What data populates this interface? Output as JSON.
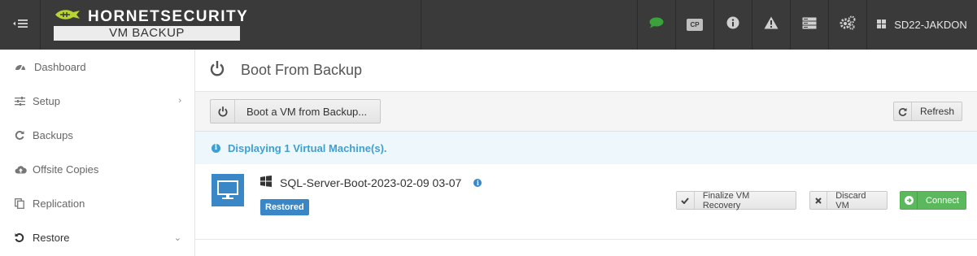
{
  "brand": {
    "name": "HORNETSECURITY",
    "product": "VM BACKUP"
  },
  "topnav": {
    "icons": [
      "chat-icon",
      "cp-icon",
      "info-icon",
      "warning-icon",
      "server-icon",
      "settings-icon"
    ],
    "cp_label": "CP",
    "user": "SD22-JAKDON"
  },
  "sidebar": {
    "items": [
      {
        "label": "Dashboard",
        "icon": "dashboard-icon"
      },
      {
        "label": "Setup",
        "icon": "sliders-icon",
        "chevron": "›"
      },
      {
        "label": "Backups",
        "icon": "refresh-icon"
      },
      {
        "label": "Offsite Copies",
        "icon": "cloud-upload-icon"
      },
      {
        "label": "Replication",
        "icon": "copy-icon"
      },
      {
        "label": "Restore",
        "icon": "undo-icon",
        "chevron": "⌄"
      }
    ]
  },
  "page": {
    "title": "Boot From Backup"
  },
  "toolbar": {
    "boot_label": "Boot a VM from Backup...",
    "refresh_label": "Refresh"
  },
  "info": {
    "message": "Displaying 1 Virtual Machine(s)."
  },
  "vm": {
    "name": "SQL-Server-Boot-2023-02-09 03-07",
    "status": "Restored",
    "actions": {
      "finalize": "Finalize VM Recovery",
      "discard": "Discard VM",
      "connect": "Connect"
    }
  },
  "colors": {
    "topbar": "#3a3a3a",
    "accent_blue": "#3a87c8",
    "info_text": "#3f9fcf",
    "connect_green": "#5cb85c",
    "chat_green": "#3aa23a"
  }
}
